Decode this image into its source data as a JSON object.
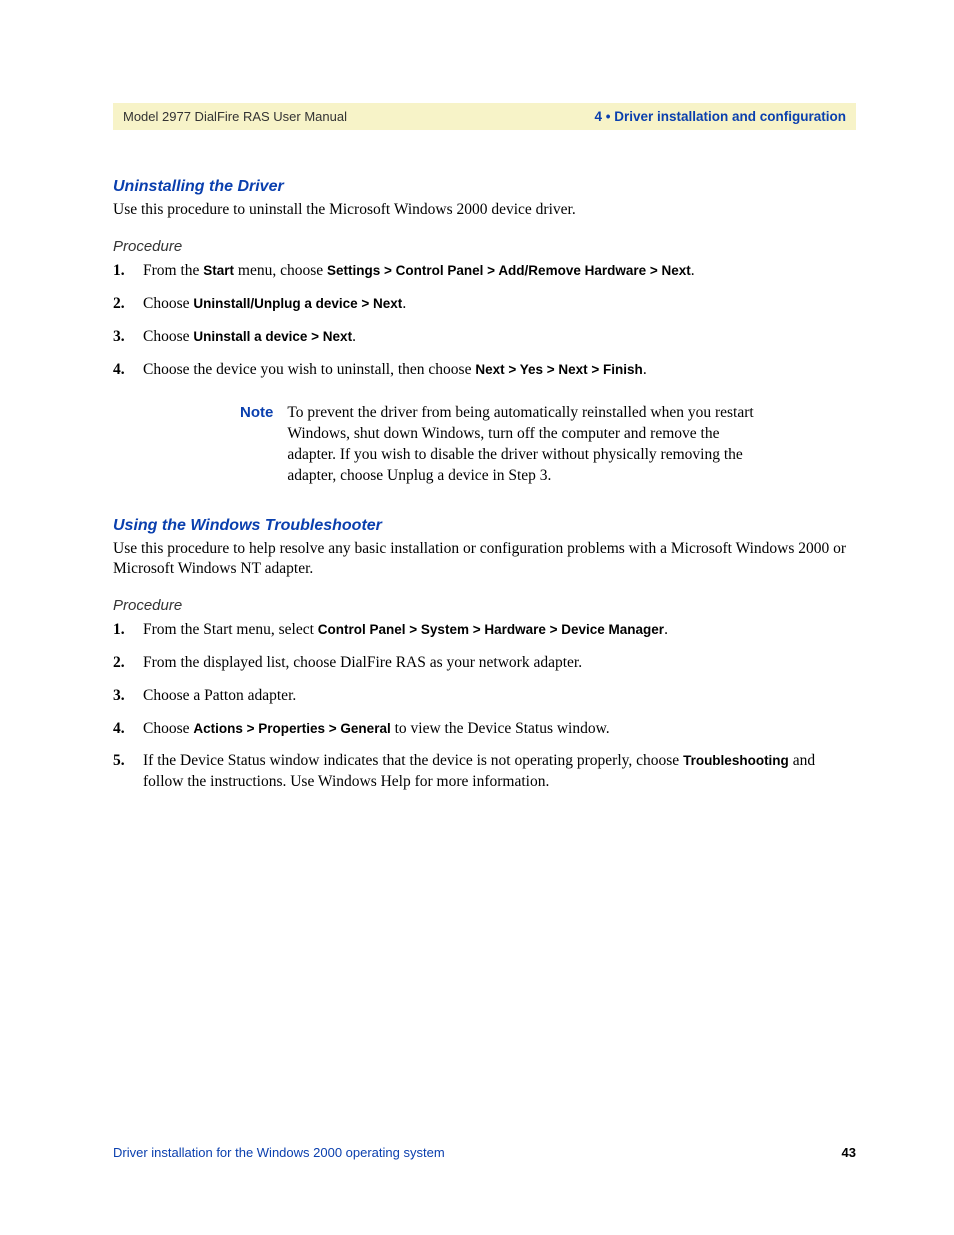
{
  "header": {
    "left": "Model 2977 DialFire RAS User Manual",
    "right": "4 • Driver installation and configuration"
  },
  "section1": {
    "heading": "Uninstalling the Driver",
    "intro": "Use this procedure to uninstall the Microsoft Windows 2000 device driver.",
    "procedure_label": "Procedure",
    "steps": {
      "s1_a": "From the ",
      "s1_b": "Start",
      "s1_c": " menu, choose ",
      "s1_d": "Settings > Control Panel > Add/Remove Hardware > Next",
      "s1_e": ".",
      "s2_a": "Choose ",
      "s2_b": "Uninstall/Unplug a device > Next",
      "s2_c": ".",
      "s3_a": "Choose ",
      "s3_b": "Uninstall a device > Next",
      "s3_c": ".",
      "s4_a": "Choose the device you wish to uninstall, then choose ",
      "s4_b": "Next > Yes > Next > Finish",
      "s4_c": "."
    },
    "note_label": "Note",
    "note_text": "To prevent the driver from being automatically reinstalled when you restart Windows, shut down Windows, turn off the computer and remove the adapter. If you wish to disable the driver without physically removing the adapter, choose Unplug a device in Step 3."
  },
  "section2": {
    "heading": "Using the Windows Troubleshooter",
    "intro": "Use this procedure to help resolve any basic installation or configuration problems with a Microsoft Windows 2000 or Microsoft Windows NT adapter.",
    "procedure_label": "Procedure",
    "steps": {
      "s1_a": "From the Start menu, select ",
      "s1_b": "Control Panel > System > Hardware > Device Manager",
      "s1_c": ".",
      "s2": "From the displayed list, choose DialFire RAS as your network adapter.",
      "s3": "Choose a Patton adapter.",
      "s4_a": "Choose ",
      "s4_b": "Actions > Properties > General",
      "s4_c": " to view the Device Status window.",
      "s5_a": "If the Device Status window indicates that the device is not operating properly, choose ",
      "s5_b": "Troubleshooting",
      "s5_c": " and follow the instructions. Use Windows Help for more information."
    }
  },
  "footer": {
    "left": "Driver installation for the Windows 2000 operating system",
    "right": "43"
  }
}
